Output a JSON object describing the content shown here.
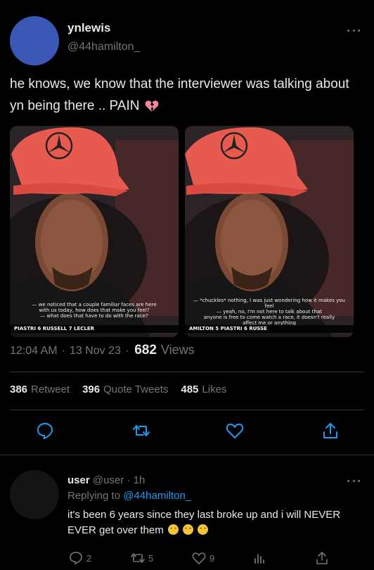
{
  "tweet": {
    "display_name": "ynlewis",
    "handle": "@44hamilton_",
    "text": "he knows, we know that the interviewer was talking about yn being there .. PAIN",
    "media": [
      {
        "subtitle_lines": [
          "— we noticed that a couple familiar faces are here",
          "with us today, how does that make you feel?",
          "— what does that have to do with the race?"
        ],
        "ticker": "PIASTRI    6  RUSSELL    7  LECLER"
      },
      {
        "subtitle_lines": [
          "— *chuckles* nothing, I was just wondering how it makes you feel",
          "— yeah, no, I'm not here to talk about that",
          "anyone is free to come watch a race, it doesn't really",
          "affect me or anything"
        ],
        "ticker": "AMILTON    5  PIASTRI    6  RUSSE"
      }
    ],
    "time": "12:04 AM",
    "date": "13 Nov 23",
    "views_count": "682",
    "views_label": "Views",
    "stats": {
      "retweets": "386",
      "retweets_label": "Retweet",
      "quotes": "396",
      "quotes_label": "Quote Tweets",
      "likes": "485",
      "likes_label": "Likes"
    }
  },
  "reply": {
    "display_name": "user",
    "handle": "@user",
    "time": "1h",
    "replying_prefix": "Replying to",
    "replying_to": "@44hamilton_",
    "text": "it's been 6 years since they last broke up and i will NEVER EVER get over them",
    "reply_count": "2",
    "retweet_count": "5",
    "like_count": "9"
  },
  "colors": {
    "background": "#000000",
    "text": "#e7e9ea",
    "muted": "#71767b",
    "accent": "#1d9bf0",
    "avatar": "#3a57b5"
  },
  "icons": [
    "more-icon",
    "broken-heart-icon",
    "reply-icon",
    "retweet-icon",
    "like-icon",
    "share-icon",
    "analytics-icon",
    "crying-emoji-icon"
  ]
}
